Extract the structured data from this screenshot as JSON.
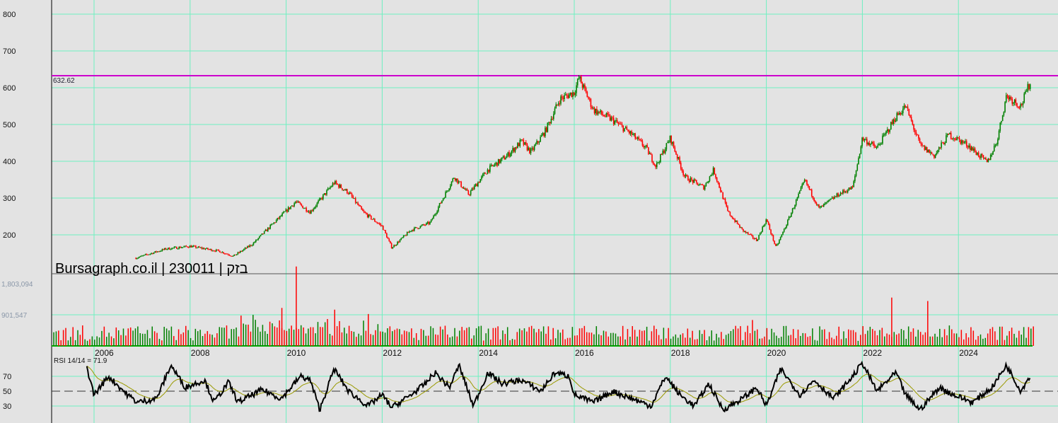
{
  "chart_data": {
    "type": "candlestick",
    "title": "Bursagraph.co.il | 230011 | בזק",
    "price_axis": {
      "ticks": [
        200,
        300,
        400,
        500,
        600,
        700,
        800
      ],
      "ylim": [
        130,
        830
      ]
    },
    "resistance_line": {
      "value": 632.62,
      "label": "632.62",
      "color": "#cc00cc"
    },
    "x_ticks": [
      "2006",
      "2008",
      "2010",
      "2012",
      "2014",
      "2016",
      "2018",
      "2020",
      "2022",
      "2024"
    ],
    "xlim": [
      2005.15,
      2026.1
    ],
    "price": [
      [
        2006.87,
        137
      ],
      [
        2007.5,
        162
      ],
      [
        2008,
        169
      ],
      [
        2008.6,
        156
      ],
      [
        2008.9,
        142
      ],
      [
        2009.3,
        175
      ],
      [
        2009.7,
        227
      ],
      [
        2010.2,
        290
      ],
      [
        2010.5,
        262
      ],
      [
        2011.0,
        342
      ],
      [
        2011.3,
        315
      ],
      [
        2011.6,
        262
      ],
      [
        2012.0,
        223
      ],
      [
        2012.2,
        165
      ],
      [
        2012.6,
        213
      ],
      [
        2013.0,
        233
      ],
      [
        2013.5,
        358
      ],
      [
        2013.8,
        310
      ],
      [
        2014.2,
        377
      ],
      [
        2014.6,
        415
      ],
      [
        2014.9,
        454
      ],
      [
        2015.1,
        425
      ],
      [
        2015.4,
        483
      ],
      [
        2015.7,
        569
      ],
      [
        2016.0,
        588
      ],
      [
        2016.1,
        627
      ],
      [
        2016.4,
        540
      ],
      [
        2016.8,
        512
      ],
      [
        2017.2,
        473
      ],
      [
        2017.5,
        435
      ],
      [
        2017.7,
        387
      ],
      [
        2018.0,
        463
      ],
      [
        2018.3,
        358
      ],
      [
        2018.7,
        329
      ],
      [
        2018.9,
        377
      ],
      [
        2019.2,
        262
      ],
      [
        2019.5,
        213
      ],
      [
        2019.8,
        185
      ],
      [
        2020.0,
        242
      ],
      [
        2020.2,
        165
      ],
      [
        2020.4,
        223
      ],
      [
        2020.8,
        348
      ],
      [
        2021.1,
        271
      ],
      [
        2021.5,
        310
      ],
      [
        2021.8,
        329
      ],
      [
        2022.0,
        463
      ],
      [
        2022.3,
        435
      ],
      [
        2022.7,
        521
      ],
      [
        2022.9,
        550
      ],
      [
        2023.2,
        444
      ],
      [
        2023.5,
        415
      ],
      [
        2023.8,
        473
      ],
      [
        2024.2,
        444
      ],
      [
        2024.6,
        396
      ],
      [
        2024.8,
        454
      ],
      [
        2025.0,
        579
      ],
      [
        2025.3,
        550
      ],
      [
        2025.5,
        617
      ]
    ],
    "volume": {
      "ticks": [
        "1,803,094",
        "901,547"
      ],
      "tick_values": [
        1803094,
        901547
      ],
      "spikes": [
        [
          2010.2,
          2300000
        ],
        [
          2009.9,
          1100000
        ],
        [
          2011.0,
          1050000
        ],
        [
          2022.6,
          1400000
        ],
        [
          2023.35,
          1300000
        ],
        [
          2019.7,
          750000
        ]
      ]
    },
    "rsi": {
      "label": "RSI 14/14 = 71.9",
      "ticks": [
        70,
        50,
        30
      ],
      "ylim": [
        15,
        95
      ],
      "values": [
        [
          2005.85,
          82
        ],
        [
          2006.0,
          45
        ],
        [
          2006.3,
          70
        ],
        [
          2006.7,
          45
        ],
        [
          2006.9,
          35
        ],
        [
          2007.3,
          40
        ],
        [
          2007.6,
          85
        ],
        [
          2007.9,
          55
        ],
        [
          2008.3,
          65
        ],
        [
          2008.5,
          35
        ],
        [
          2008.8,
          62
        ],
        [
          2009.0,
          35
        ],
        [
          2009.5,
          52
        ],
        [
          2009.9,
          40
        ],
        [
          2010.3,
          70
        ],
        [
          2010.5,
          65
        ],
        [
          2010.7,
          25
        ],
        [
          2011.0,
          80
        ],
        [
          2011.3,
          50
        ],
        [
          2011.7,
          30
        ],
        [
          2012.0,
          45
        ],
        [
          2012.2,
          28
        ],
        [
          2012.6,
          45
        ],
        [
          2012.9,
          60
        ],
        [
          2013.1,
          75
        ],
        [
          2013.4,
          55
        ],
        [
          2013.6,
          85
        ],
        [
          2013.9,
          30
        ],
        [
          2014.2,
          75
        ],
        [
          2014.5,
          60
        ],
        [
          2014.9,
          65
        ],
        [
          2015.3,
          50
        ],
        [
          2015.6,
          75
        ],
        [
          2015.9,
          70
        ],
        [
          2016.0,
          45
        ],
        [
          2016.4,
          35
        ],
        [
          2016.8,
          50
        ],
        [
          2017.2,
          40
        ],
        [
          2017.6,
          30
        ],
        [
          2017.9,
          70
        ],
        [
          2018.2,
          45
        ],
        [
          2018.5,
          30
        ],
        [
          2018.8,
          60
        ],
        [
          2019.1,
          25
        ],
        [
          2019.5,
          40
        ],
        [
          2019.8,
          55
        ],
        [
          2020.0,
          30
        ],
        [
          2020.3,
          80
        ],
        [
          2020.7,
          45
        ],
        [
          2021.0,
          65
        ],
        [
          2021.4,
          40
        ],
        [
          2021.8,
          70
        ],
        [
          2022.0,
          88
        ],
        [
          2022.3,
          50
        ],
        [
          2022.7,
          75
        ],
        [
          2022.9,
          45
        ],
        [
          2023.2,
          25
        ],
        [
          2023.6,
          55
        ],
        [
          2023.9,
          45
        ],
        [
          2024.3,
          35
        ],
        [
          2024.7,
          55
        ],
        [
          2025.0,
          85
        ],
        [
          2025.3,
          50
        ],
        [
          2025.5,
          72
        ]
      ]
    },
    "colors": {
      "up": "#008000",
      "down": "#ff0000",
      "grid": "#6ff0c0",
      "rsi": "#000000",
      "rsi_signal": "#9a9a00",
      "midline": "#cc0000"
    }
  }
}
